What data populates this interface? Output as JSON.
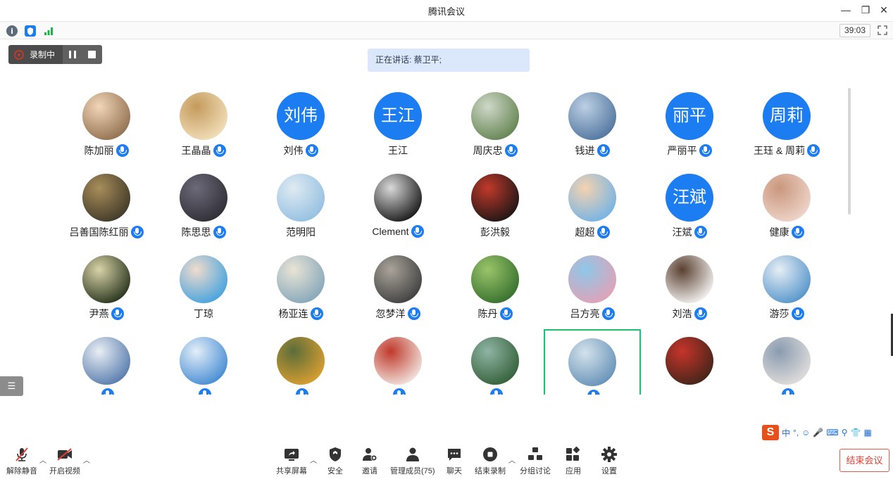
{
  "window": {
    "title": "腾讯会议"
  },
  "infobar": {
    "timer": "39:03"
  },
  "recording": {
    "label": "录制中"
  },
  "speaking": {
    "text": "正在讲话: 蔡卫平;"
  },
  "participants": [
    {
      "name": "陈加丽",
      "avatar_text": "",
      "colors": [
        "#8a6a4a",
        "#f2d6b8"
      ],
      "mic": true
    },
    {
      "name": "王晶晶",
      "avatar_text": "",
      "colors": [
        "#f5e3c0",
        "#c49a5c"
      ],
      "mic": true
    },
    {
      "name": "刘伟",
      "avatar_text": "刘伟",
      "mic": true
    },
    {
      "name": "王江",
      "avatar_text": "王江",
      "mic": false
    },
    {
      "name": "周庆忠",
      "avatar_text": "",
      "colors": [
        "#5d7f4a",
        "#cfd8c8"
      ],
      "mic": true
    },
    {
      "name": "钱进",
      "avatar_text": "",
      "colors": [
        "#4b6f9b",
        "#bcd0e3"
      ],
      "mic": true
    },
    {
      "name": "严丽平",
      "avatar_text": "丽平",
      "mic": true
    },
    {
      "name": "王珏 & 周莉",
      "avatar_text": "周莉",
      "mic": true
    },
    {
      "name": "吕善国陈红丽",
      "avatar_text": "",
      "colors": [
        "#3a3426",
        "#a88d5a"
      ],
      "mic": true
    },
    {
      "name": "陈思思",
      "avatar_text": "",
      "colors": [
        "#2b2b33",
        "#6c6a78"
      ],
      "mic": true
    },
    {
      "name": "范明阳",
      "avatar_text": "",
      "colors": [
        "#8fbde0",
        "#dfeaf2"
      ],
      "mic": false
    },
    {
      "name": "Clement",
      "avatar_text": "",
      "colors": [
        "#0d0d0d",
        "#d9d9d9"
      ],
      "mic": true
    },
    {
      "name": "彭洪毅",
      "avatar_text": "",
      "colors": [
        "#141414",
        "#c0392b"
      ],
      "mic": false
    },
    {
      "name": "超超",
      "avatar_text": "",
      "colors": [
        "#6cb2e8",
        "#f4d2b0"
      ],
      "mic": true
    },
    {
      "name": "汪斌",
      "avatar_text": "汪斌",
      "mic": true
    },
    {
      "name": "健康",
      "avatar_text": "",
      "colors": [
        "#f1d9cf",
        "#c9977d"
      ],
      "mic": true
    },
    {
      "name": "尹燕",
      "avatar_text": "",
      "colors": [
        "#1d2a14",
        "#d8d3a8"
      ],
      "mic": true
    },
    {
      "name": "丁琼",
      "avatar_text": "",
      "colors": [
        "#3a9fe0",
        "#f0dccc"
      ],
      "mic": false
    },
    {
      "name": "杨亚连",
      "avatar_text": "",
      "colors": [
        "#7fa3b8",
        "#e9e4d6"
      ],
      "mic": true
    },
    {
      "name": "忽梦洋",
      "avatar_text": "",
      "colors": [
        "#3a3a3a",
        "#a9a39a"
      ],
      "mic": true
    },
    {
      "name": "陈丹",
      "avatar_text": "",
      "colors": [
        "#2f6b2a",
        "#9bc46a"
      ],
      "mic": true
    },
    {
      "name": "吕方亮",
      "avatar_text": "",
      "colors": [
        "#e6a0b4",
        "#8ec7e8"
      ],
      "mic": true
    },
    {
      "name": "刘浩",
      "avatar_text": "",
      "colors": [
        "#ffffff",
        "#5a4030"
      ],
      "mic": true
    },
    {
      "name": "游莎",
      "avatar_text": "",
      "colors": [
        "#4c8fc8",
        "#e6eef4"
      ],
      "mic": true
    },
    {
      "name": "",
      "avatar_text": "",
      "colors": [
        "#4d74a8",
        "#e9eef4"
      ],
      "mic": true
    },
    {
      "name": "",
      "avatar_text": "",
      "colors": [
        "#3b86d1",
        "#e4eef8"
      ],
      "mic": true
    },
    {
      "name": "",
      "avatar_text": "",
      "colors": [
        "#e2a230",
        "#5b6d3a"
      ],
      "mic": true
    },
    {
      "name": "",
      "avatar_text": "",
      "colors": [
        "#f4f0ea",
        "#c0392b"
      ],
      "mic": true
    },
    {
      "name": "",
      "avatar_text": "",
      "colors": [
        "#2e5b32",
        "#8fb4a4"
      ],
      "mic": true
    },
    {
      "name": "",
      "avatar_text": "",
      "colors": [
        "#5f8db4",
        "#d4e2ec"
      ],
      "mic": true
    },
    {
      "name": "",
      "avatar_text": "",
      "colors": [
        "#3b2418",
        "#c6342b"
      ],
      "mic": false
    },
    {
      "name": "",
      "avatar_text": "",
      "colors": [
        "#e6e2de",
        "#8a9bb0"
      ],
      "mic": true
    }
  ],
  "active_tile_index": 29,
  "ime": {
    "items": [
      "中",
      "°,",
      "☺",
      "🎤",
      "⌨",
      "⚲",
      "👕",
      "▦"
    ]
  },
  "toolbar": {
    "unmute": "解除静音",
    "video": "开启视频",
    "share": "共享屏幕",
    "security": "安全",
    "invite": "邀请",
    "manage": "管理成员(75)",
    "chat": "聊天",
    "end_record": "结束录制",
    "breakout": "分组讨论",
    "apps": "应用",
    "settings": "设置",
    "end_meeting": "结束会议"
  },
  "colors": {
    "accent": "#1c7cf2",
    "end_red": "#e03f34",
    "active_border": "#1dbf73"
  }
}
